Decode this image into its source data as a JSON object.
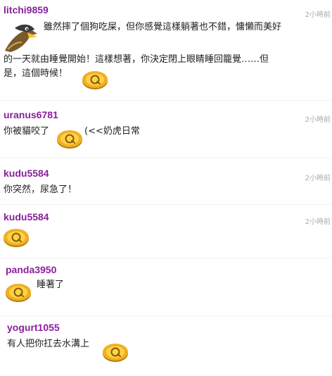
{
  "comments": [
    {
      "user": "litchi9859",
      "time": "2小時前",
      "lines": [
        "雖然摔了個狗吃屎，但你感覺這樣躺著也不錯，慵懶而美好",
        "的一天就由睡覺開始！這樣想著，你決定閉上眼睛睡回籠覺……但",
        "是，這個時候！"
      ],
      "avatar_icon": "bird-avatar-icon"
    },
    {
      "user": "uranus6781",
      "time": "2小時前",
      "before": "你被貓咬了",
      "after": "(<<奶虎日常"
    },
    {
      "user": "kudu5584",
      "time": "2小時前",
      "text": "你突然，尿急了！"
    },
    {
      "user": "kudu5584",
      "time": "2小時前"
    },
    {
      "user": "panda3950",
      "text": "睡著了"
    },
    {
      "user": "yogurt1055",
      "text": "有人把你扛去水溝上"
    }
  ],
  "icons": {
    "coin": "gold-coin-icon"
  },
  "colors": {
    "username": "#8a1f9c",
    "timestamp": "#aaaaaa",
    "coin": "#f0b020"
  }
}
